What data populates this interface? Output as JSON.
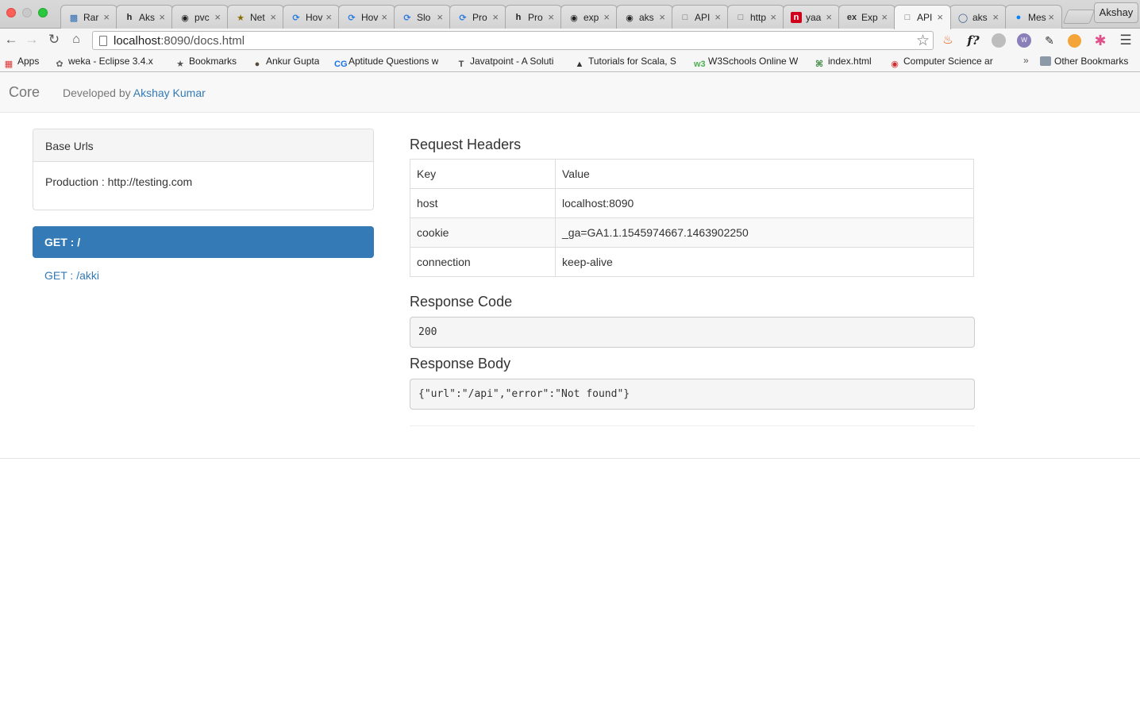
{
  "browser": {
    "tabs": [
      {
        "label": "Rar",
        "icon": "cluster-icon",
        "color": "#2d6db5"
      },
      {
        "label": "Aks",
        "icon": "hashnode-h-icon",
        "color": "#222222"
      },
      {
        "label": "pvc",
        "icon": "github-icon",
        "color": "#222222"
      },
      {
        "label": "Net",
        "icon": "star-badge-icon",
        "color": "#8a6d00"
      },
      {
        "label": "Hov",
        "icon": "sync-icon",
        "color": "#2a7ae2"
      },
      {
        "label": "Hov",
        "icon": "sync-icon",
        "color": "#2a7ae2"
      },
      {
        "label": "Slo",
        "icon": "sync-icon",
        "color": "#2a7ae2"
      },
      {
        "label": "Pro",
        "icon": "sync-icon",
        "color": "#2a7ae2"
      },
      {
        "label": "Pro",
        "icon": "hashnode-h-icon",
        "color": "#222222"
      },
      {
        "label": "exp",
        "icon": "github-icon",
        "color": "#222222"
      },
      {
        "label": "aks",
        "icon": "github-icon",
        "color": "#222222"
      },
      {
        "label": "API",
        "icon": "page-icon",
        "color": "#666666"
      },
      {
        "label": "http",
        "icon": "page-icon",
        "color": "#666666"
      },
      {
        "label": "yaa",
        "icon": "red-square-icon",
        "color": "#d0021b"
      },
      {
        "label": "Exp",
        "icon": "ex-icon",
        "color": "#333333"
      },
      {
        "label": "API",
        "icon": "page-icon",
        "color": "#666666"
      },
      {
        "label": "aks",
        "icon": "stack-icon",
        "color": "#3a5a8c"
      },
      {
        "label": "Mes",
        "icon": "messenger-icon",
        "color": "#0084ff"
      }
    ],
    "active_tab_index": 15,
    "profile_name": "Akshay",
    "url_host": "localhost",
    "url_rest": ":8090/docs.html",
    "bookmarks": [
      {
        "label": "Apps",
        "icon": "apps-grid-icon"
      },
      {
        "label": "weka - Eclipse 3.4.x",
        "icon": "weka-bird-icon"
      },
      {
        "label": "Bookmarks",
        "icon": "star-icon"
      },
      {
        "label": "Ankur Gupta",
        "icon": "avatar-icon"
      },
      {
        "label": "Aptitude Questions w",
        "icon": "cg-icon"
      },
      {
        "label": "Javatpoint - A Soluti",
        "icon": "t-icon"
      },
      {
        "label": "Tutorials for Scala, S",
        "icon": "tutorials-icon"
      },
      {
        "label": "W3Schools Online W",
        "icon": "w3-icon"
      },
      {
        "label": "index.html",
        "icon": "clover-icon"
      },
      {
        "label": "Computer Science ar",
        "icon": "cs-icon"
      }
    ],
    "overflow_chevron": "»",
    "other_bookmarks": "Other Bookmarks"
  },
  "navbar": {
    "brand": "Core",
    "developed_by": "Developed by ",
    "author": "Akshay Kumar"
  },
  "base_urls": {
    "heading": "Base Urls",
    "production": "Production : http://testing.com"
  },
  "routes": [
    {
      "label": "GET : /",
      "active": true
    },
    {
      "label": "GET : /akki",
      "active": false
    }
  ],
  "request_headers": {
    "title": "Request Headers",
    "columns": [
      "Key",
      "Value"
    ],
    "rows": [
      {
        "key": "host",
        "value": "localhost:8090"
      },
      {
        "key": "cookie",
        "value": "_ga=GA1.1.1545974667.1463902250"
      },
      {
        "key": "connection",
        "value": "keep-alive"
      }
    ]
  },
  "response_code": {
    "title": "Response Code",
    "value": "200"
  },
  "response_body": {
    "title": "Response Body",
    "value": "{\"url\":\"/api\",\"error\":\"Not found\"}"
  },
  "colors": {
    "primary": "#337ab7",
    "navbar_bg": "#f8f8f8"
  }
}
